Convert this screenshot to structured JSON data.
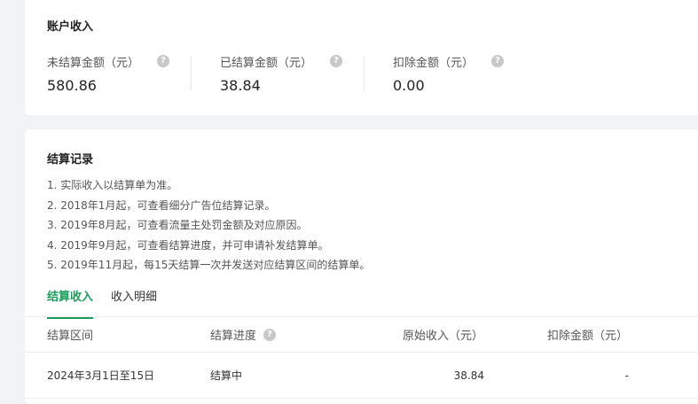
{
  "income": {
    "title": "账户收入",
    "stats": [
      {
        "label": "未结算金额（元）",
        "value": "580.86"
      },
      {
        "label": "已结算金额（元）",
        "value": "38.84"
      },
      {
        "label": "扣除金额（元）",
        "value": "0.00"
      }
    ]
  },
  "records": {
    "title": "结算记录",
    "notes": [
      "1. 实际收入以结算单为准。",
      "2. 2018年1月起，可查看细分广告位结算记录。",
      "3. 2019年8月起，可查看流量主处罚金额及对应原因。",
      "4. 2019年9月起，可查看结算进度，并可申请补发结算单。",
      "5. 2019年11月起，每15天结算一次并发送对应结算区间的结算单。"
    ],
    "tabs": [
      {
        "label": "结算收入",
        "active": true
      },
      {
        "label": "收入明细",
        "active": false
      }
    ],
    "table": {
      "headers": [
        "结算区间",
        "结算进度",
        "原始收入（元）",
        "扣除金额（元）"
      ],
      "rows": [
        [
          "2024年3月1日至15日",
          "结算中",
          "38.84",
          "-"
        ]
      ]
    }
  },
  "icons": {
    "help": "question-circle-icon"
  },
  "colors": {
    "accent": "#1a9d5b",
    "background": "#f2f3f5"
  }
}
